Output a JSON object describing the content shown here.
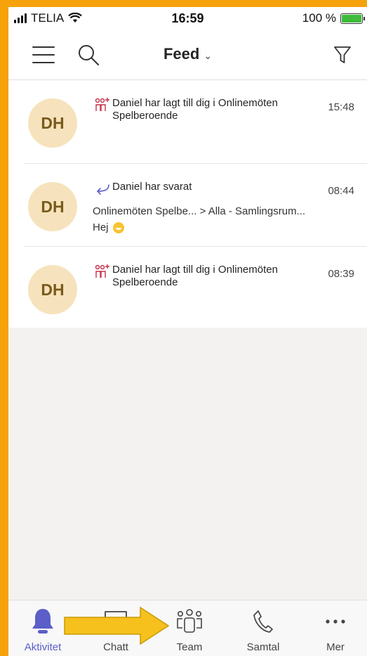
{
  "status": {
    "carrier": "TELIA",
    "time": "16:59",
    "battery": "100 %"
  },
  "header": {
    "title": "Feed",
    "chevron": "⌄"
  },
  "feed": [
    {
      "avatar": "DH",
      "icon": "add-member-icon",
      "title": "Daniel har lagt till dig i Onlinemöten Spelberoende",
      "time": "15:48"
    },
    {
      "avatar": "DH",
      "icon": "reply-icon",
      "title": "Daniel har svarat",
      "time": "08:44",
      "path": "Onlinemöten Spelbe... > Alla - Samlingsrum...",
      "message": "Hej"
    },
    {
      "avatar": "DH",
      "icon": "add-member-icon",
      "title": "Daniel har lagt till dig i Onlinemöten Spelberoende",
      "time": "08:39"
    }
  ],
  "nav": {
    "activity": "Aktivitet",
    "chat": "Chatt",
    "team": "Team",
    "calls": "Samtal",
    "more": "Mer"
  },
  "colors": {
    "accent": "#5b5fc7",
    "avatar_bg": "#f6e3bd",
    "frame": "#f5a20b",
    "arrow": "#f6c11d"
  }
}
